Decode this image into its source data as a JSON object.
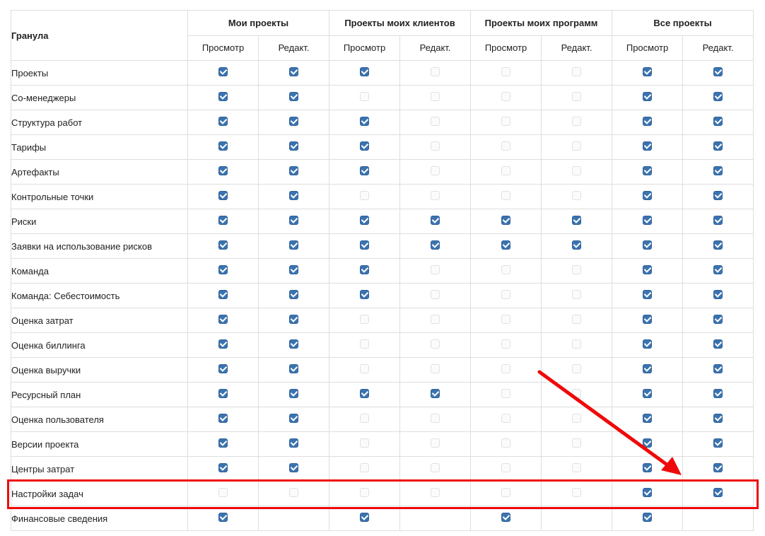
{
  "table": {
    "granule_header": "Гранула",
    "groups": [
      "Мои проекты",
      "Проекты моих клиентов",
      "Проекты моих программ",
      "Все проекты"
    ],
    "sub_headers": [
      "Просмотр",
      "Редакт.",
      "Просмотр",
      "Редакт.",
      "Просмотр",
      "Редакт.",
      "Просмотр",
      "Редакт."
    ],
    "rows": [
      {
        "label": "Проекты",
        "cells": [
          1,
          1,
          1,
          0,
          0,
          0,
          1,
          1
        ]
      },
      {
        "label": "Со-менеджеры",
        "cells": [
          1,
          1,
          0,
          0,
          0,
          0,
          1,
          1
        ]
      },
      {
        "label": "Структура работ",
        "cells": [
          1,
          1,
          1,
          0,
          0,
          0,
          1,
          1
        ]
      },
      {
        "label": "Тарифы",
        "cells": [
          1,
          1,
          1,
          0,
          0,
          0,
          1,
          1
        ]
      },
      {
        "label": "Артефакты",
        "cells": [
          1,
          1,
          1,
          0,
          0,
          0,
          1,
          1
        ]
      },
      {
        "label": "Контрольные точки",
        "cells": [
          1,
          1,
          0,
          0,
          0,
          0,
          1,
          1
        ]
      },
      {
        "label": "Риски",
        "cells": [
          1,
          1,
          1,
          1,
          1,
          1,
          1,
          1
        ]
      },
      {
        "label": "Заявки на использование рисков",
        "cells": [
          1,
          1,
          1,
          1,
          1,
          1,
          1,
          1
        ]
      },
      {
        "label": "Команда",
        "cells": [
          1,
          1,
          1,
          0,
          0,
          0,
          1,
          1
        ]
      },
      {
        "label": "Команда: Себестоимость",
        "cells": [
          1,
          1,
          1,
          0,
          0,
          0,
          1,
          1
        ]
      },
      {
        "label": "Оценка затрат",
        "cells": [
          1,
          1,
          0,
          0,
          0,
          0,
          1,
          1
        ]
      },
      {
        "label": "Оценка биллинга",
        "cells": [
          1,
          1,
          0,
          0,
          0,
          0,
          1,
          1
        ]
      },
      {
        "label": "Оценка выручки",
        "cells": [
          1,
          1,
          0,
          0,
          0,
          0,
          1,
          1
        ]
      },
      {
        "label": "Ресурсный план",
        "cells": [
          1,
          1,
          1,
          1,
          0,
          0,
          1,
          1
        ]
      },
      {
        "label": "Оценка пользователя",
        "cells": [
          1,
          1,
          0,
          0,
          0,
          0,
          1,
          1
        ]
      },
      {
        "label": "Версии проекта",
        "cells": [
          1,
          1,
          0,
          0,
          0,
          0,
          1,
          1
        ]
      },
      {
        "label": "Центры затрат",
        "cells": [
          1,
          1,
          0,
          0,
          0,
          0,
          1,
          1
        ]
      },
      {
        "label": "Настройки задач",
        "cells": [
          0,
          0,
          0,
          0,
          0,
          0,
          1,
          1
        ],
        "highlighted": true
      },
      {
        "label": "Финансовые сведения",
        "cells": [
          1,
          null,
          1,
          null,
          1,
          null,
          1,
          null
        ]
      }
    ]
  },
  "annotation": {
    "color": "#ee0a0a",
    "highlighted_row": "Настройки задач"
  },
  "colors": {
    "checkbox_checked": "#3b73af",
    "checkbox_unchecked_border": "#e1e1e1",
    "grid": "#dedede"
  }
}
